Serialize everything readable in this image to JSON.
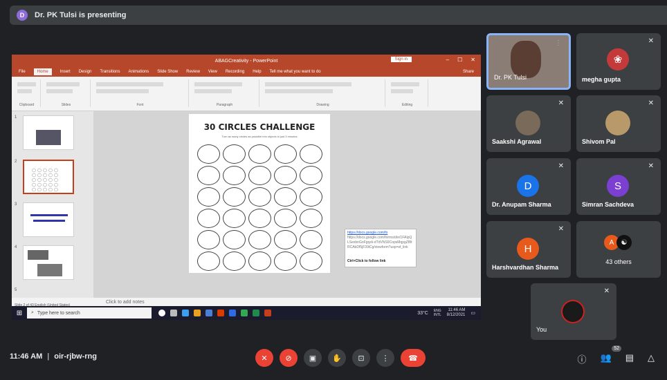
{
  "banner": {
    "initial": "D",
    "text": "Dr. PK Tulsi is presenting"
  },
  "ppt": {
    "title": "ABAGCreativity - PowerPoint",
    "sign_in": "Sign in",
    "tabs": [
      "File",
      "Home",
      "Insert",
      "Design",
      "Transitions",
      "Animations",
      "Slide Show",
      "Review",
      "View",
      "Recording",
      "Help",
      "Tell me what you want to do",
      "Share"
    ],
    "ribbon_groups": [
      "Clipboard",
      "Slides",
      "Font",
      "Paragraph",
      "Drawing",
      "Editing"
    ],
    "slide_title": "30 CIRCLES CHALLENGE",
    "slide_subtitle": "Turn as many circles as possible into objects in just 3 minutes",
    "thumb_numbers": [
      "1",
      "2",
      "3",
      "4",
      "5"
    ],
    "notes_placeholder": "Click to add notes",
    "status": "Slide 2 of 43   English (United States)",
    "link_url": "https://docs.google.com/fo",
    "link_full": "https://docs.google.com/forms/d/e/1FAIpQLSexbnGoFgqzk-dTdVNS9CopsMqpgZf8tRCAbDf5jF39iCg/viewform?usp=sf_link",
    "link_hint": "Ctrl+Click to follow link",
    "taskbar_search": "Type here to search",
    "weather": "33°C",
    "lang": "ENG\nINTL",
    "sys_time": "11:46 AM",
    "sys_date": "8/12/2021"
  },
  "participants": [
    {
      "name": "Dr. PK Tulsi"
    },
    {
      "name": "megha gupta"
    },
    {
      "name": "Saakshi Agrawal"
    },
    {
      "name": "Shivom Pal"
    },
    {
      "name": "Dr. Anupam Sharma",
      "initial": "D",
      "color": "#1a73e8"
    },
    {
      "name": "Simran Sachdeva",
      "initial": "S",
      "color": "#7b3fd1"
    },
    {
      "name": "Harshvardhan Sharma",
      "initial": "H",
      "color": "#e8591c"
    },
    {
      "name": "43 others",
      "initial": "A",
      "color": "#e8591c"
    },
    {
      "name": "You"
    }
  ],
  "meeting": {
    "time": "11:46 AM",
    "code": "oir-rjbw-rng",
    "participant_count": "52"
  },
  "colors": {
    "end_call": "#ea4335",
    "accent": "#8ab4f8"
  }
}
